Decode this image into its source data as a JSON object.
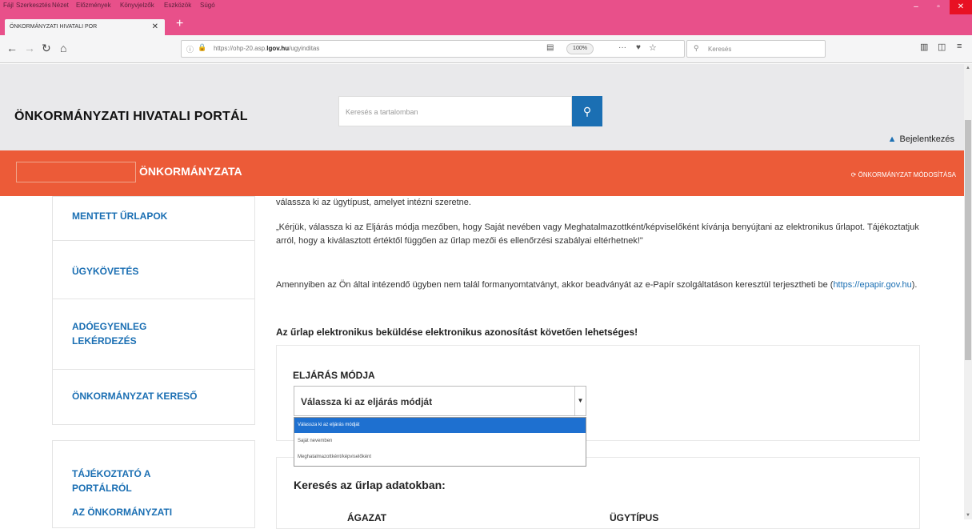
{
  "browser": {
    "menu": [
      "Fájl",
      "Szerkesztés",
      "Nézet",
      "Előzmények",
      "Könyvjelzők",
      "Eszközök",
      "Súgó"
    ],
    "tab_title": "ÖNKORMÁNYZATI HIVATALI POR",
    "url_prefix": "https://ohp-20.asp.",
    "url_domain": "lgov.hu",
    "url_suffix": "/ugyinditas",
    "zoom": "100%",
    "search_placeholder": "Keresés"
  },
  "portal": {
    "title": "ÖNKORMÁNYZATI HIVATALI PORTÁL",
    "search_placeholder": "Keresés a tartalomban",
    "login_label": "Bejelentkezés",
    "org_name": "ÖNKORMÁNYZATA",
    "org_modify": "ÖNKORMÁNYZAT MÓDOSÍTÁSA"
  },
  "sidebar": {
    "items": [
      {
        "label": "MENTETT ŰRLAPOK"
      },
      {
        "label": "ÜGYKÖVETÉS"
      },
      {
        "label": "ADÓEGYENLEG LEKÉRDEZÉS"
      },
      {
        "label": "ÖNKORMÁNYZAT KERESŐ"
      }
    ],
    "info_items": [
      {
        "label": "TÁJÉKOZTATÓ A PORTÁLRÓL"
      },
      {
        "label": "AZ ÖNKORMÁNYZATI"
      }
    ]
  },
  "main": {
    "para_top": "válassza ki az ügytípust, amelyet intézni szeretne.",
    "para_method": "„Kérjük, válassza ki az Eljárás módja mezőben, hogy Saját nevében vagy Meghatalmazottként/képviselőként kívánja benyújtani az elektronikus űrlapot. Tájékoztatjuk arról, hogy a kiválasztott értéktől függően az űrlap mezői és ellenőrzési szabályai eltérhetnek!\"",
    "para_epapir": "Amennyiben az Ön által intézendő ügyben nem talál formanyomtatványt, akkor beadványát az e-Papír szolgáltatáson keresztül terjesztheti be (",
    "epapir_link": "https://epapir.gov.hu",
    "para_epapir_end": ").",
    "notice": "Az űrlap elektronikus beküldése elektronikus azonosítást követően lehetséges!",
    "method_label": "ELJÁRÁS MÓDJA",
    "method_selected": "Válassza ki az eljárás módját",
    "method_options": [
      "Válassza ki az eljárás módját",
      "Saját nevemben",
      "Meghatalmazottként/képviselőként"
    ],
    "search_heading": "Keresés az űrlap adatokban:",
    "col_sector": "ÁGAZAT",
    "col_type": "ÜGYTÍPUS"
  }
}
